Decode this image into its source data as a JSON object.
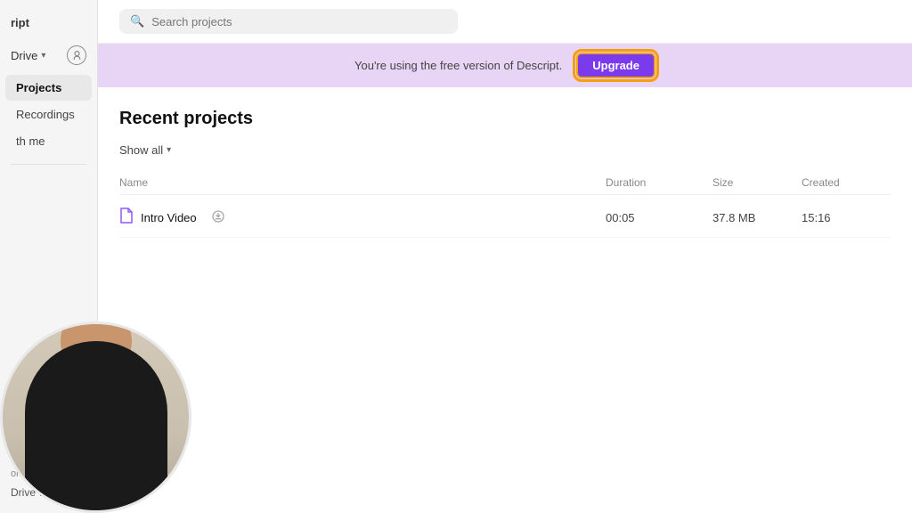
{
  "app": {
    "name": "ript"
  },
  "sidebar": {
    "drive_label": "Drive",
    "nav_items": [
      {
        "id": "projects",
        "label": "Projects",
        "active": true
      },
      {
        "id": "recordings",
        "label": "Recordings"
      },
      {
        "id": "shared",
        "label": "th me"
      }
    ],
    "workspace_label": "orkspace",
    "drive_workspace_label": "Drive workspac"
  },
  "search": {
    "placeholder": "Search projects",
    "value": ""
  },
  "banner": {
    "message": "You're using the free version of Descript.",
    "upgrade_label": "Upgrade"
  },
  "main": {
    "section_title": "Recent projects",
    "show_all_label": "Show all",
    "table": {
      "headers": {
        "name": "Name",
        "duration": "Duration",
        "size": "Size",
        "created": "Created"
      },
      "rows": [
        {
          "name": "Intro Video",
          "duration": "00:05",
          "size": "37.8 MB",
          "created": "15:16"
        }
      ]
    }
  },
  "colors": {
    "accent_purple": "#7c3aed",
    "banner_bg": "#e8d5f5",
    "upgrade_border": "#f59e0b"
  }
}
